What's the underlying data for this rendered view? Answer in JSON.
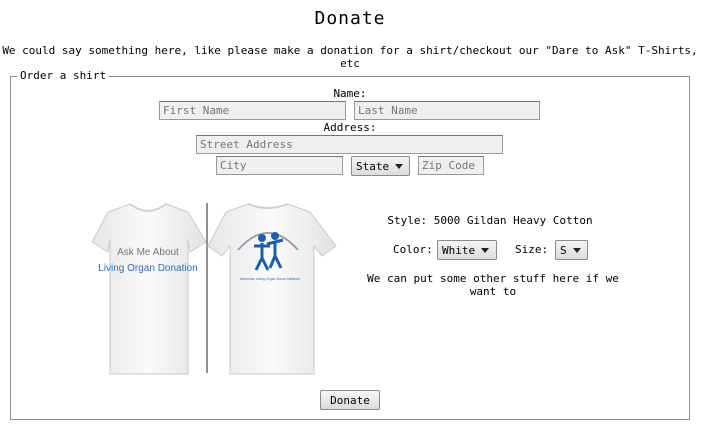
{
  "page": {
    "title": "Donate",
    "intro": "We could say something here, like please make a donation for a shirt/checkout our \"Dare to Ask\" T-Shirts, etc"
  },
  "form": {
    "legend": "Order a shirt",
    "name_label": "Name:",
    "first_name_placeholder": "First Name",
    "last_name_placeholder": "Last Name",
    "address_label": "Address:",
    "street_placeholder": "Street Address",
    "city_placeholder": "City",
    "state_selected": "State",
    "zip_placeholder": "Zip Code"
  },
  "shirt": {
    "front_text_line1": "Ask Me About",
    "front_text_line2": "Living Organ Donation",
    "back_text": "American Living Organ Donor Network",
    "style_text": "Style: 5000 Gildan Heavy Cotton",
    "color_label": "Color:",
    "color_selected": "White",
    "size_label": "Size:",
    "size_selected": "S",
    "note": "We can put some other stuff here if we want to"
  },
  "actions": {
    "donate_label": "Donate"
  },
  "colors": {
    "border": "#8c8c8c",
    "input_bg": "#efefef",
    "shirt_logo_blue": "#2f6fb5"
  }
}
